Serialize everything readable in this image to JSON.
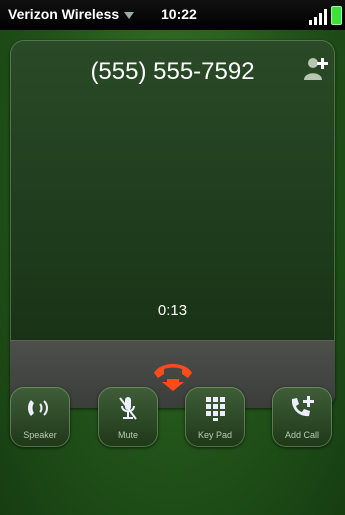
{
  "status_bar": {
    "carrier": "Verizon Wireless",
    "time": "10:22"
  },
  "call": {
    "phone_number": "(555) 555-7592",
    "duration": "0:13"
  },
  "buttons": {
    "speaker": "Speaker",
    "mute": "Mute",
    "keypad": "Key Pad",
    "add_call": "Add Call"
  },
  "colors": {
    "end_call": "#ff4a1a",
    "battery": "#3fe03a",
    "frame": "#22541a"
  },
  "icons": {
    "speaker": "speaker-icon",
    "mute": "mic-muted-icon",
    "keypad": "keypad-icon",
    "add_call": "add-call-icon",
    "end_call": "end-call-icon",
    "add_contact": "add-contact-icon"
  }
}
